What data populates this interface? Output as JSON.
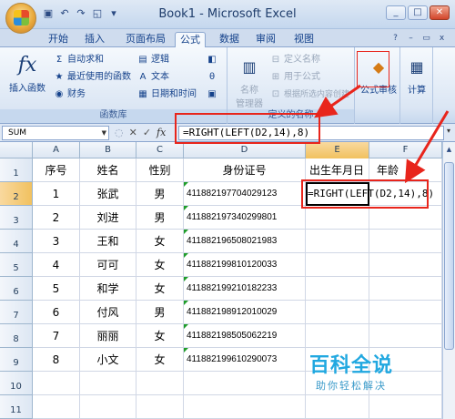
{
  "window": {
    "title": "Book1 - Microsoft Excel",
    "qat_icons": [
      "save-icon",
      "undo-icon",
      "redo-icon",
      "preview-icon",
      "dropdown-icon"
    ],
    "controls": [
      "_",
      "□",
      "✕"
    ]
  },
  "tabs": [
    "开始",
    "插入",
    "页面布局",
    "公式",
    "数据",
    "审阅",
    "视图"
  ],
  "active_tab": "公式",
  "ribbon": {
    "insert_function": "插入函数",
    "autosum": "自动求和",
    "recent": "最近使用的函数",
    "financial": "财务",
    "logical": "逻辑",
    "text": "文本",
    "datetime": "日期和时间",
    "name_manager_1": "名称",
    "name_manager_2": "管理器",
    "define_name": "定义名称",
    "use_in_formula": "用于公式",
    "create_from_sel": "根据所选内容创建",
    "group_library": "函数库",
    "group_names": "定义的名称",
    "audit": "公式审核",
    "calc": "计算"
  },
  "formula_bar": {
    "name_box": "SUM",
    "cancel": "✕",
    "enter": "✓",
    "fx": "fx",
    "formula": "=RIGHT(LEFT(D2,14),8)"
  },
  "columns": [
    "A",
    "B",
    "C",
    "D",
    "E",
    "F"
  ],
  "rows": [
    "1",
    "2",
    "3",
    "4",
    "5",
    "6",
    "7",
    "8",
    "9",
    "10",
    "11"
  ],
  "headers": [
    "序号",
    "姓名",
    "性别",
    "身份证号",
    "出生年月日",
    "年龄"
  ],
  "data": [
    {
      "no": "1",
      "name": "张武",
      "sex": "男",
      "id": "411882197704029123"
    },
    {
      "no": "2",
      "name": "刘进",
      "sex": "男",
      "id": "411882197340299801"
    },
    {
      "no": "3",
      "name": "王和",
      "sex": "女",
      "id": "411882196508021983"
    },
    {
      "no": "4",
      "name": "可可",
      "sex": "女",
      "id": "411882199810120033"
    },
    {
      "no": "5",
      "name": "和学",
      "sex": "女",
      "id": "411882199210182233"
    },
    {
      "no": "6",
      "name": "付风",
      "sex": "男",
      "id": "411882198912010029"
    },
    {
      "no": "7",
      "name": "丽丽",
      "sex": "女",
      "id": "411882198505062219"
    },
    {
      "no": "8",
      "name": "小文",
      "sex": "女",
      "id": "411882199610290073"
    }
  ],
  "active_cell_content": "=RIGHT(LEFT(D2,14),8)",
  "watermark": {
    "line1": "百科全说",
    "line2": "助你轻松解决"
  },
  "accent_colors": {
    "annotation_red": "#e8251c",
    "watermark_blue": "#21a8e0"
  }
}
